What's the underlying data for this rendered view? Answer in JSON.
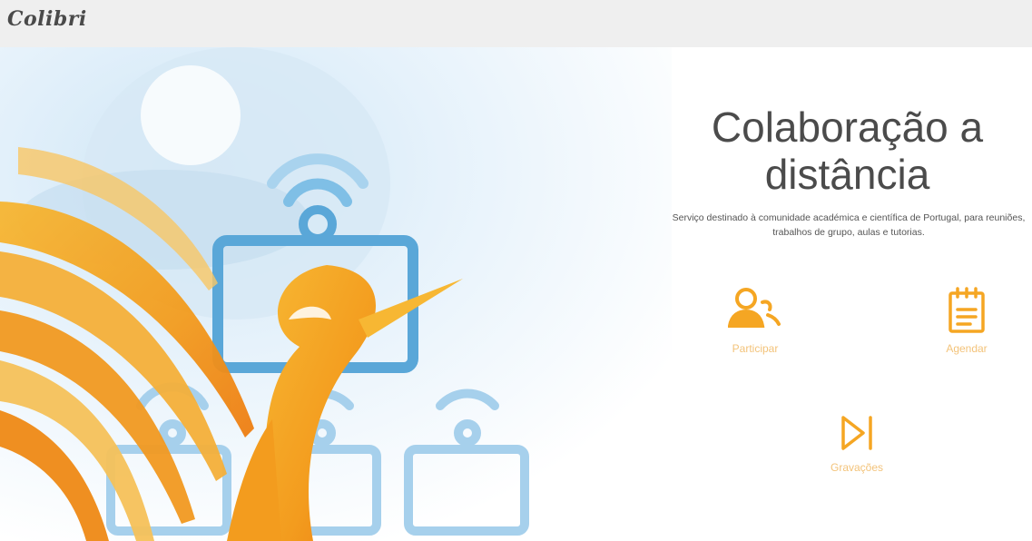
{
  "header": {
    "logo_text": "Colibri"
  },
  "main": {
    "title_line1": "Colaboração a",
    "title_line2": "distância",
    "subtitle": "Serviço destinado à comunidade académica e científica de Portugal, para reuniões, trabalhos de grupo, aulas e tutorias.",
    "actions": [
      {
        "label": "Participar",
        "icon": "users-icon"
      },
      {
        "label": "Agendar",
        "icon": "calendar-notepad-icon"
      },
      {
        "label": "Gravações",
        "icon": "play-skip-icon"
      }
    ]
  },
  "colors": {
    "accent": "#f5a623",
    "label": "#f3c37a",
    "title": "#4b4b4b",
    "topbar": "#efefef",
    "art_blue": "#6fb3dd"
  }
}
